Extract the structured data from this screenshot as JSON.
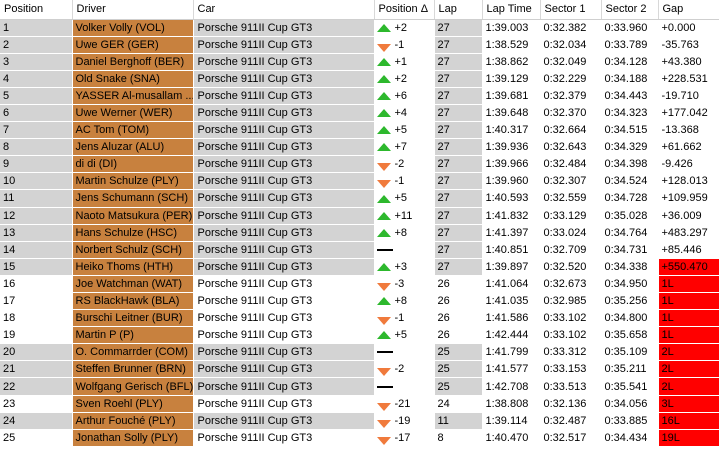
{
  "columns": [
    "Position",
    "Driver",
    "Car",
    "Position Δ",
    "Lap",
    "Lap Time",
    "Sector 1",
    "Sector 2",
    "Gap"
  ],
  "colors": {
    "driver_bg": "#c8813e",
    "grey_row": "#d3d3d3",
    "gap_lapped": "#ff0000",
    "up": "#2db82d",
    "down": "#f07a3c"
  },
  "rows": [
    {
      "pos": "1",
      "driver": "Volker Volly (VOL)",
      "car": "Porsche 911II Cup GT3",
      "dir": "up",
      "delta": "+2",
      "lap": "27",
      "lt": "1:39.003",
      "s1": "0:32.382",
      "s2": "0:33.960",
      "gap": "+0.000",
      "lapped": false,
      "grey": true
    },
    {
      "pos": "2",
      "driver": "Uwe GER (GER)",
      "car": "Porsche 911II Cup GT3",
      "dir": "down",
      "delta": "-1",
      "lap": "27",
      "lt": "1:38.529",
      "s1": "0:32.034",
      "s2": "0:33.789",
      "gap": "-35.763",
      "lapped": false,
      "grey": true
    },
    {
      "pos": "3",
      "driver": "Daniel Berghoff (BER)",
      "car": "Porsche 911II Cup GT3",
      "dir": "up",
      "delta": "+1",
      "lap": "27",
      "lt": "1:38.862",
      "s1": "0:32.049",
      "s2": "0:34.128",
      "gap": "+43.380",
      "lapped": false,
      "grey": true
    },
    {
      "pos": "4",
      "driver": "Old Snake (SNA)",
      "car": "Porsche 911II Cup GT3",
      "dir": "up",
      "delta": "+2",
      "lap": "27",
      "lt": "1:39.129",
      "s1": "0:32.229",
      "s2": "0:34.188",
      "gap": "+228.531",
      "lapped": false,
      "grey": true
    },
    {
      "pos": "5",
      "driver": "YASSER Al-musallam ...",
      "car": "Porsche 911II Cup GT3",
      "dir": "up",
      "delta": "+6",
      "lap": "27",
      "lt": "1:39.681",
      "s1": "0:32.379",
      "s2": "0:34.443",
      "gap": "-19.710",
      "lapped": false,
      "grey": true
    },
    {
      "pos": "6",
      "driver": "Uwe Werner (WER)",
      "car": "Porsche 911II Cup GT3",
      "dir": "up",
      "delta": "+4",
      "lap": "27",
      "lt": "1:39.648",
      "s1": "0:32.370",
      "s2": "0:34.323",
      "gap": "+177.042",
      "lapped": false,
      "grey": true
    },
    {
      "pos": "7",
      "driver": "AC Tom (TOM)",
      "car": "Porsche 911II Cup GT3",
      "dir": "up",
      "delta": "+5",
      "lap": "27",
      "lt": "1:40.317",
      "s1": "0:32.664",
      "s2": "0:34.515",
      "gap": "-13.368",
      "lapped": false,
      "grey": true
    },
    {
      "pos": "8",
      "driver": "Jens Aluzar (ALU)",
      "car": "Porsche 911II Cup GT3",
      "dir": "up",
      "delta": "+7",
      "lap": "27",
      "lt": "1:39.936",
      "s1": "0:32.643",
      "s2": "0:34.329",
      "gap": "+61.662",
      "lapped": false,
      "grey": true
    },
    {
      "pos": "9",
      "driver": "di di (DI)",
      "car": "Porsche 911II Cup GT3",
      "dir": "down",
      "delta": "-2",
      "lap": "27",
      "lt": "1:39.966",
      "s1": "0:32.484",
      "s2": "0:34.398",
      "gap": "-9.426",
      "lapped": false,
      "grey": true
    },
    {
      "pos": "10",
      "driver": "Martin Schulze (PLY)",
      "car": "Porsche 911II Cup GT3",
      "dir": "down",
      "delta": "-1",
      "lap": "27",
      "lt": "1:39.960",
      "s1": "0:32.307",
      "s2": "0:34.524",
      "gap": "+128.013",
      "lapped": false,
      "grey": true
    },
    {
      "pos": "11",
      "driver": "Jens Schumann (SCH)",
      "car": "Porsche 911II Cup GT3",
      "dir": "up",
      "delta": "+5",
      "lap": "27",
      "lt": "1:40.593",
      "s1": "0:32.559",
      "s2": "0:34.728",
      "gap": "+109.959",
      "lapped": false,
      "grey": true
    },
    {
      "pos": "12",
      "driver": "Naoto Matsukura (PER)",
      "car": "Porsche 911II Cup GT3",
      "dir": "up",
      "delta": "+11",
      "lap": "27",
      "lt": "1:41.832",
      "s1": "0:33.129",
      "s2": "0:35.028",
      "gap": "+36.009",
      "lapped": false,
      "grey": true
    },
    {
      "pos": "13",
      "driver": "Hans Schulze (HSC)",
      "car": "Porsche 911II Cup GT3",
      "dir": "up",
      "delta": "+8",
      "lap": "27",
      "lt": "1:41.397",
      "s1": "0:33.024",
      "s2": "0:34.764",
      "gap": "+483.297",
      "lapped": false,
      "grey": true
    },
    {
      "pos": "14",
      "driver": "Norbert Schulz (SCH)",
      "car": "Porsche 911II Cup GT3",
      "dir": "none",
      "delta": "",
      "lap": "27",
      "lt": "1:40.851",
      "s1": "0:32.709",
      "s2": "0:34.731",
      "gap": "+85.446",
      "lapped": false,
      "grey": true
    },
    {
      "pos": "15",
      "driver": "Heiko Thoms (HTH)",
      "car": "Porsche 911II Cup GT3",
      "dir": "up",
      "delta": "+3",
      "lap": "27",
      "lt": "1:39.897",
      "s1": "0:32.520",
      "s2": "0:34.338",
      "gap": "+550.470",
      "lapped": true,
      "grey": true
    },
    {
      "pos": "16",
      "driver": "Joe Watchman (WAT)",
      "car": "Porsche 911II Cup GT3",
      "dir": "down",
      "delta": "-3",
      "lap": "26",
      "lt": "1:41.064",
      "s1": "0:32.673",
      "s2": "0:34.950",
      "gap": "1L",
      "lapped": true,
      "grey": false
    },
    {
      "pos": "17",
      "driver": "RS BlackHawk (BLA)",
      "car": "Porsche 911II Cup GT3",
      "dir": "up",
      "delta": "+8",
      "lap": "26",
      "lt": "1:41.035",
      "s1": "0:32.985",
      "s2": "0:35.256",
      "gap": "1L",
      "lapped": true,
      "grey": false
    },
    {
      "pos": "18",
      "driver": "Burschi Leitner (BUR)",
      "car": "Porsche 911II Cup GT3",
      "dir": "down",
      "delta": "-1",
      "lap": "26",
      "lt": "1:41.586",
      "s1": "0:33.102",
      "s2": "0:34.800",
      "gap": "1L",
      "lapped": true,
      "grey": false
    },
    {
      "pos": "19",
      "driver": "Martin P (P)",
      "car": "Porsche 911II Cup GT3",
      "dir": "up",
      "delta": "+5",
      "lap": "26",
      "lt": "1:42.444",
      "s1": "0:33.102",
      "s2": "0:35.658",
      "gap": "1L",
      "lapped": true,
      "grey": false
    },
    {
      "pos": "20",
      "driver": "O. Commarrder (COM)",
      "car": "Porsche 911II Cup GT3",
      "dir": "none",
      "delta": "",
      "lap": "25",
      "lt": "1:41.799",
      "s1": "0:33.312",
      "s2": "0:35.109",
      "gap": "2L",
      "lapped": true,
      "grey": true
    },
    {
      "pos": "21",
      "driver": "Steffen Brunner (BRN)",
      "car": "Porsche 911II Cup GT3",
      "dir": "down",
      "delta": "-2",
      "lap": "25",
      "lt": "1:41.577",
      "s1": "0:33.153",
      "s2": "0:35.211",
      "gap": "2L",
      "lapped": true,
      "grey": true
    },
    {
      "pos": "22",
      "driver": "Wolfgang Gerisch (BFL)",
      "car": "Porsche 911II Cup GT3",
      "dir": "none",
      "delta": "",
      "lap": "25",
      "lt": "1:42.708",
      "s1": "0:33.513",
      "s2": "0:35.541",
      "gap": "2L",
      "lapped": true,
      "grey": true
    },
    {
      "pos": "23",
      "driver": "Sven Roehl (PLY)",
      "car": "Porsche 911II Cup GT3",
      "dir": "down",
      "delta": "-21",
      "lap": "24",
      "lt": "1:38.808",
      "s1": "0:32.136",
      "s2": "0:34.056",
      "gap": "3L",
      "lapped": true,
      "grey": false
    },
    {
      "pos": "24",
      "driver": "Arthur Fouché (PLY)",
      "car": "Porsche 911II Cup GT3",
      "dir": "down",
      "delta": "-19",
      "lap": "11",
      "lt": "1:39.114",
      "s1": "0:32.487",
      "s2": "0:33.885",
      "gap": "16L",
      "lapped": true,
      "grey": true
    },
    {
      "pos": "25",
      "driver": "Jonathan Solly (PLY)",
      "car": "Porsche 911II Cup GT3",
      "dir": "down",
      "delta": "-17",
      "lap": "8",
      "lt": "1:40.470",
      "s1": "0:32.517",
      "s2": "0:34.434",
      "gap": "19L",
      "lapped": true,
      "grey": false
    }
  ]
}
